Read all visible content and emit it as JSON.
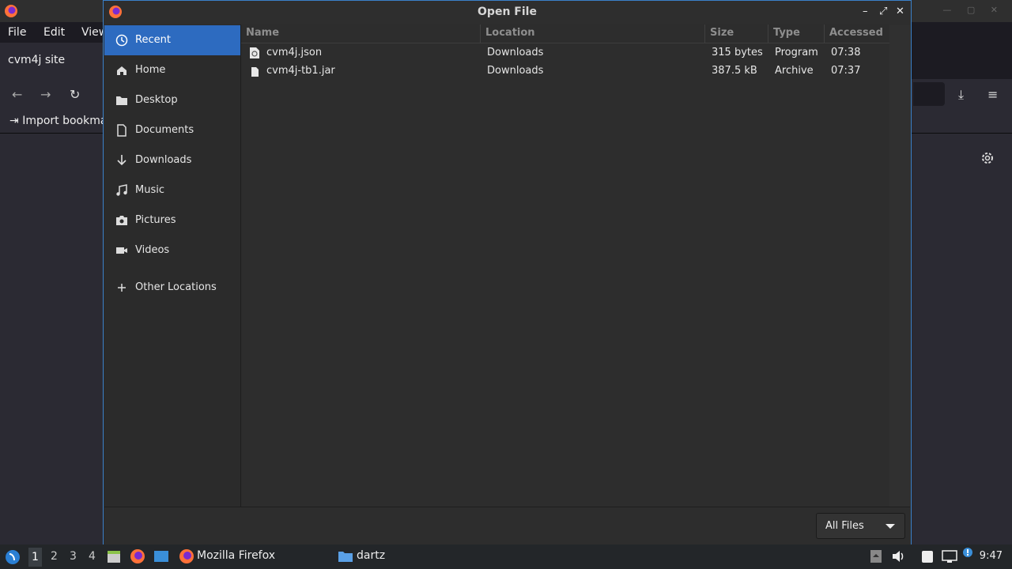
{
  "firefox": {
    "menu": [
      "File",
      "Edit",
      "View"
    ],
    "tab_title": "cvm4j site",
    "bookmark_label": "Import bookma"
  },
  "dialog": {
    "title": "Open File",
    "places": [
      {
        "label": "Recent",
        "icon": "clock-icon",
        "selected": true
      },
      {
        "label": "Home",
        "icon": "home-icon"
      },
      {
        "label": "Desktop",
        "icon": "folder-icon"
      },
      {
        "label": "Documents",
        "icon": "document-icon"
      },
      {
        "label": "Downloads",
        "icon": "download-icon"
      },
      {
        "label": "Music",
        "icon": "music-icon"
      },
      {
        "label": "Pictures",
        "icon": "camera-icon"
      },
      {
        "label": "Videos",
        "icon": "video-icon"
      },
      {
        "label": "Other Locations",
        "icon": "plus-icon"
      }
    ],
    "columns": {
      "name": "Name",
      "location": "Location",
      "size": "Size",
      "type": "Type",
      "accessed": "Accessed"
    },
    "files": [
      {
        "name": "cvm4j.json",
        "location": "Downloads",
        "size": "315 bytes",
        "type": "Program",
        "accessed": "07:38",
        "icon": "script-file-icon"
      },
      {
        "name": "cvm4j-tb1.jar",
        "location": "Downloads",
        "size": "387.5 kB",
        "type": "Archive",
        "accessed": "07:37",
        "icon": "file-icon"
      }
    ],
    "filter": "All Files"
  },
  "taskbar": {
    "workspaces": [
      "1",
      "2",
      "3",
      "4"
    ],
    "tasks": [
      "Mozilla Firefox",
      "dartz"
    ],
    "clock": "9:47"
  },
  "colors": {
    "selection": "#2d6bc0",
    "accent_border": "#3a80c9",
    "dialog_bg": "#2d2d2d"
  }
}
